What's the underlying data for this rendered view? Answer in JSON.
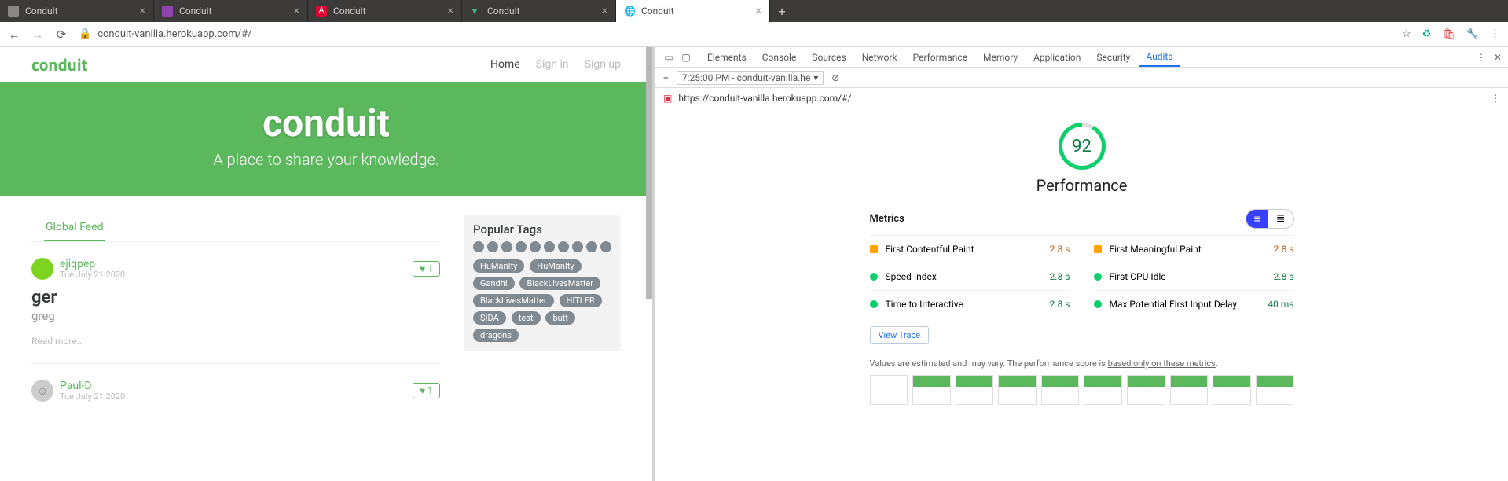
{
  "browser": {
    "tabs": [
      {
        "title": "Conduit",
        "fav": "#888"
      },
      {
        "title": "Conduit",
        "fav": "#8e44ad"
      },
      {
        "title": "Conduit",
        "fav": "#dd0031"
      },
      {
        "title": "Conduit",
        "fav": "#41b883"
      },
      {
        "title": "Conduit",
        "fav": "#fff",
        "active": true
      }
    ],
    "url": "conduit-vanilla.herokuapp.com/#/"
  },
  "site": {
    "brand": "conduit",
    "nav": {
      "home": "Home",
      "signin": "Sign in",
      "signup": "Sign up"
    },
    "banner": {
      "title": "conduit",
      "tagline": "A place to share your knowledge."
    },
    "feed_tab": "Global Feed",
    "articles": [
      {
        "author": "ejiqpep",
        "date": "Tue July 21 2020",
        "likes": "1",
        "title": "ger",
        "desc": "greg",
        "more": "Read more..."
      },
      {
        "author": "Paul-D",
        "date": "Tue July 21 2020",
        "likes": "1"
      }
    ],
    "tags_title": "Popular Tags",
    "tags": [
      "HuManIty",
      "HuManIty",
      "Gandhi",
      "BlackLivesMatter",
      "BlackLivesMatter",
      "HITLER",
      "SIDA",
      "test",
      "butt",
      "dragons"
    ]
  },
  "devtools": {
    "panels": [
      "Elements",
      "Console",
      "Sources",
      "Network",
      "Performance",
      "Memory",
      "Application",
      "Security",
      "Audits"
    ],
    "active_panel": "Audits",
    "run_label": "7:25:00 PM - conduit-vanilla.he",
    "url": "https://conduit-vanilla.herokuapp.com/#/",
    "score": "92",
    "category": "Performance",
    "metrics_title": "Metrics",
    "metrics": [
      {
        "name": "First Contentful Paint",
        "value": "2.8 s",
        "status": "o"
      },
      {
        "name": "First Meaningful Paint",
        "value": "2.8 s",
        "status": "o"
      },
      {
        "name": "Speed Index",
        "value": "2.8 s",
        "status": "g"
      },
      {
        "name": "First CPU Idle",
        "value": "2.8 s",
        "status": "g"
      },
      {
        "name": "Time to Interactive",
        "value": "2.8 s",
        "status": "g"
      },
      {
        "name": "Max Potential First Input Delay",
        "value": "40 ms",
        "status": "g"
      }
    ],
    "view_trace": "View Trace",
    "note_pre": "Values are estimated and may vary. The performance score is ",
    "note_link": "based only on these metrics"
  }
}
